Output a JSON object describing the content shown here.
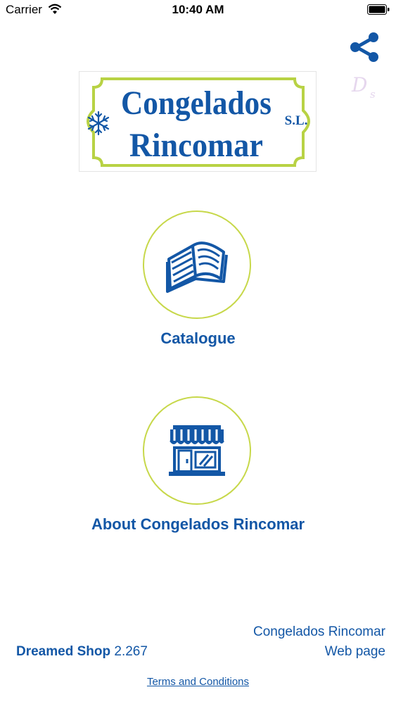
{
  "status_bar": {
    "carrier": "Carrier",
    "time": "10:40 AM"
  },
  "brand": {
    "line1": "Congelados",
    "line2": "Rincomar",
    "suffix": "S.L."
  },
  "menu": {
    "catalogue_label": "Catalogue",
    "about_label": "About Congelados Rincomar"
  },
  "footer": {
    "company_name": "Congelados Rincomar",
    "web_page": "Web page",
    "app_name": "Dreamed Shop",
    "version": "2.267",
    "terms": "Terms and Conditions"
  },
  "icons": {
    "share": "share-icon",
    "ds_logo": "ds-logo-icon",
    "catalogue": "open-book-icon",
    "about": "shop-storefront-icon",
    "snowflake": "snowflake-icon"
  },
  "colors": {
    "primary": "#1357a6",
    "accent": "#c7d84a"
  }
}
